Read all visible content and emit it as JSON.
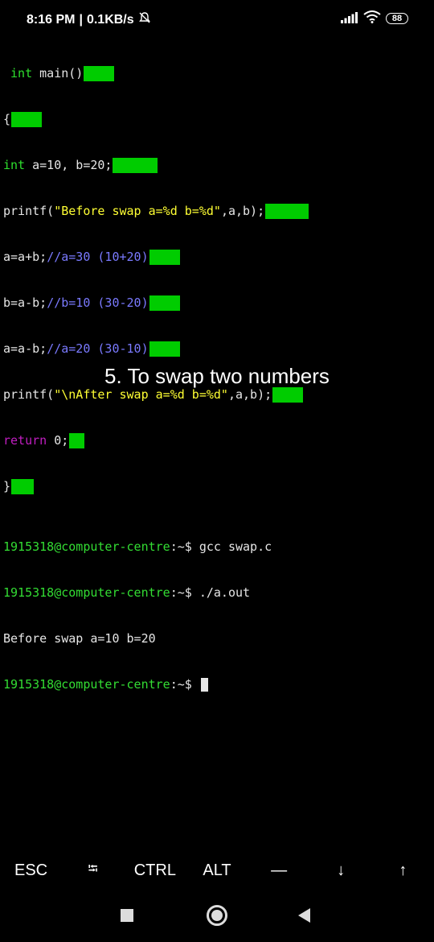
{
  "status_bar": {
    "time": "8:16 PM",
    "separator": "|",
    "speed": "0.1KB/s",
    "battery": "88",
    "icons": [
      "notification-muted-icon",
      "signal-icon",
      "wifi-icon",
      "battery-icon"
    ]
  },
  "code": {
    "line1_kw": "int",
    "line1_rest": " main()",
    "line2": "{",
    "line3_kw": "int",
    "line3_rest": " a=10, b=20;",
    "line4_pre": "printf(",
    "line4_str": "\"Before swap a=%d b=%d\"",
    "line4_post": ",a,b);",
    "line5_code": "a=a+b;",
    "line5_cmt": "//a=30 (10+20)",
    "line6_code": "b=a-b;",
    "line6_cmt": "//b=10 (30-20)",
    "line7_code": "a=a-b;",
    "line7_cmt": "//a=20 (30-10)",
    "line8_pre": "printf(",
    "line8_str": "\"\\nAfter swap a=%d b=%d\"",
    "line8_post": ",a,b);",
    "line9_kw": "return",
    "line9_rest": " 0;",
    "line10": "}"
  },
  "caption": "5. To swap two numbers",
  "terminal": {
    "prompt_user": "1915318@computer-centre",
    "prompt_path": ":~$ ",
    "cmd1": "gcc swap.c",
    "cmd2": "./a.out",
    "output1": "Before swap a=10 b=20"
  },
  "extra_keys": {
    "esc": "ESC",
    "tab": "⭾",
    "ctrl": "CTRL",
    "alt": "ALT",
    "dash": "—",
    "down": "↓",
    "up": "↑"
  },
  "colors": {
    "background": "#000000",
    "keyword_green": "#2ee02e",
    "keyword_magenta": "#c11ec1",
    "string_yellow": "#ffff33",
    "comment_blue": "#7a7aff",
    "ghost_highlight": "#00cc00"
  }
}
